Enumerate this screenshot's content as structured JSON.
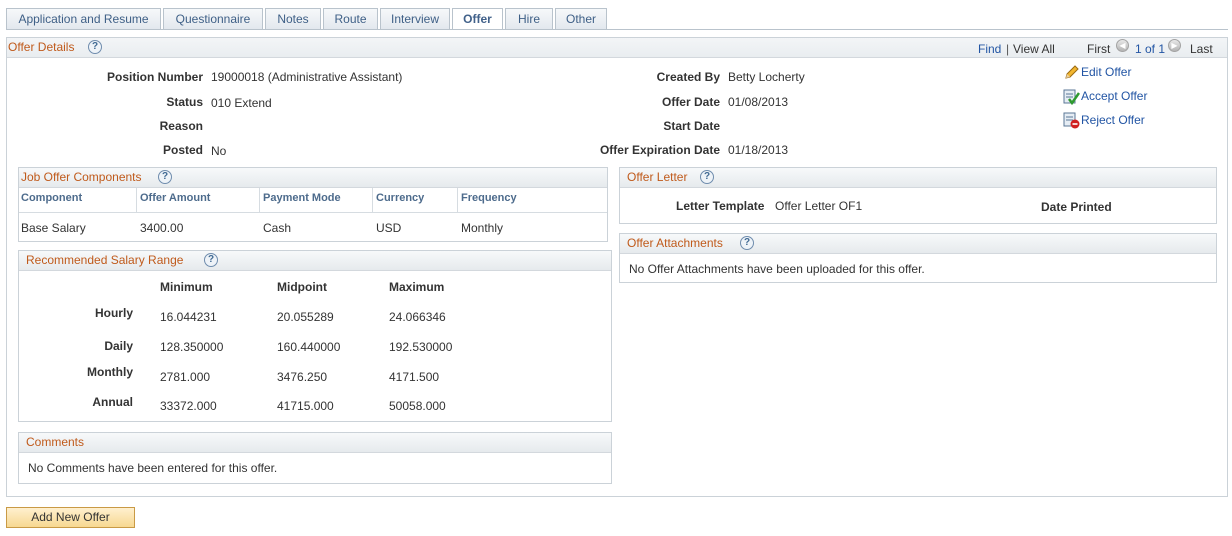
{
  "tabs": [
    "Application and Resume",
    "Questionnaire",
    "Notes",
    "Route",
    "Interview",
    "Offer",
    "Hire",
    "Other"
  ],
  "active_tab": "Offer",
  "offer_details": {
    "title": "Offer Details",
    "nav": {
      "find": "Find",
      "view_all": "View All",
      "first": "First",
      "range": "1 of 1",
      "last": "Last"
    },
    "position_number_label": "Position Number",
    "position_number": "19000018 (Administrative Assistant)",
    "status_label": "Status",
    "status": "010 Extend",
    "reason_label": "Reason",
    "reason": "",
    "posted_label": "Posted",
    "posted": "No",
    "created_by_label": "Created By",
    "created_by": "Betty Locherty",
    "offer_date_label": "Offer Date",
    "offer_date": "01/08/2013",
    "start_date_label": "Start Date",
    "start_date": "",
    "expiration_label": "Offer Expiration Date",
    "expiration": "01/18/2013",
    "actions": {
      "edit": "Edit Offer",
      "accept": "Accept Offer",
      "reject": "Reject Offer"
    }
  },
  "job_offer_components": {
    "title": "Job Offer Components",
    "columns": [
      "Component",
      "Offer Amount",
      "Payment Mode",
      "Currency",
      "Frequency"
    ],
    "rows": [
      [
        "Base Salary",
        "3400.00",
        "Cash",
        "USD",
        "Monthly"
      ]
    ]
  },
  "salary_range": {
    "title": "Recommended Salary Range",
    "columns": [
      "Minimum",
      "Midpoint",
      "Maximum"
    ],
    "rows": [
      {
        "label": "Hourly",
        "values": [
          "16.044231",
          "20.055289",
          "24.066346"
        ]
      },
      {
        "label": "Daily",
        "values": [
          "128.350000",
          "160.440000",
          "192.530000"
        ]
      },
      {
        "label": "Monthly",
        "values": [
          "2781.000",
          "3476.250",
          "4171.500"
        ]
      },
      {
        "label": "Annual",
        "values": [
          "33372.000",
          "41715.000",
          "50058.000"
        ]
      }
    ]
  },
  "comments": {
    "title": "Comments",
    "text": "No Comments have been entered for this offer."
  },
  "offer_letter": {
    "title": "Offer Letter",
    "template_label": "Letter Template",
    "template": "Offer Letter OF1",
    "date_printed_label": "Date Printed"
  },
  "attachments": {
    "title": "Offer Attachments",
    "text": "No Offer Attachments have been uploaded for this offer."
  },
  "add_button": "Add New Offer",
  "help_glyph": "?"
}
